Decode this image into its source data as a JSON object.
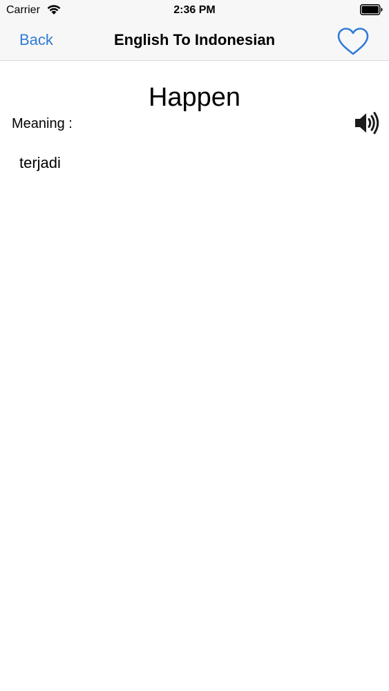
{
  "status_bar": {
    "carrier": "Carrier",
    "time": "2:36 PM"
  },
  "nav": {
    "back_label": "Back",
    "title": "English To Indonesian"
  },
  "word": {
    "term": "Happen",
    "meaning_label": "Meaning :",
    "meaning": "terjadi"
  },
  "icons": {
    "wifi": "wifi-icon",
    "battery": "battery-icon",
    "favorite": "heart-outline-icon",
    "speaker": "speaker-icon"
  },
  "colors": {
    "accent": "#2f7bd6",
    "nav_background": "#f7f7f7",
    "text": "#000000"
  }
}
